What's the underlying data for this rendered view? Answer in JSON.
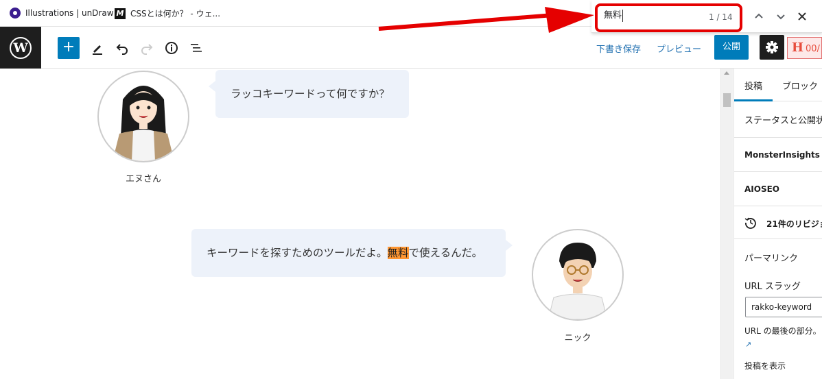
{
  "browser": {
    "bookmarks": [
      {
        "label": "Illustrations | unDraw",
        "icon": "undraw-icon"
      },
      {
        "label": "CSSとは何か？ - ウェ...",
        "icon": "m-logo-icon"
      }
    ],
    "find": {
      "query": "無料",
      "count": "1 / 14"
    }
  },
  "toolbar": {
    "add_label": "+",
    "draft_label": "下書き保存",
    "preview_label": "プレビュー",
    "publish_label": "公開",
    "h_badge_letter": "H",
    "h_badge_text": "00/"
  },
  "canvas": {
    "bubble1": "ラッコキーワードって何ですか？",
    "speaker1": "エヌさん",
    "bubble2_before": "キーワードを探すためのツールだよ。",
    "bubble2_highlight": "無料",
    "bubble2_after": "で使えるんだ。",
    "speaker2": "ニック"
  },
  "sidebar": {
    "tabs": [
      "投稿",
      "ブロック"
    ],
    "status": "ステータスと公開状",
    "monsterinsights": "MonsterInsights",
    "aioseo": "AIOSEO",
    "revisions": "21件のリビジョ",
    "permalink": "パーマリンク",
    "url_slug_label": "URL スラッグ",
    "url_slug_value": "rakko-keyword",
    "url_help": "URL の最後の部分。",
    "view_post": "投稿を表示"
  },
  "colors": {
    "accent": "#007cba",
    "highlight": "#ff9632",
    "annotation": "#e50000"
  }
}
